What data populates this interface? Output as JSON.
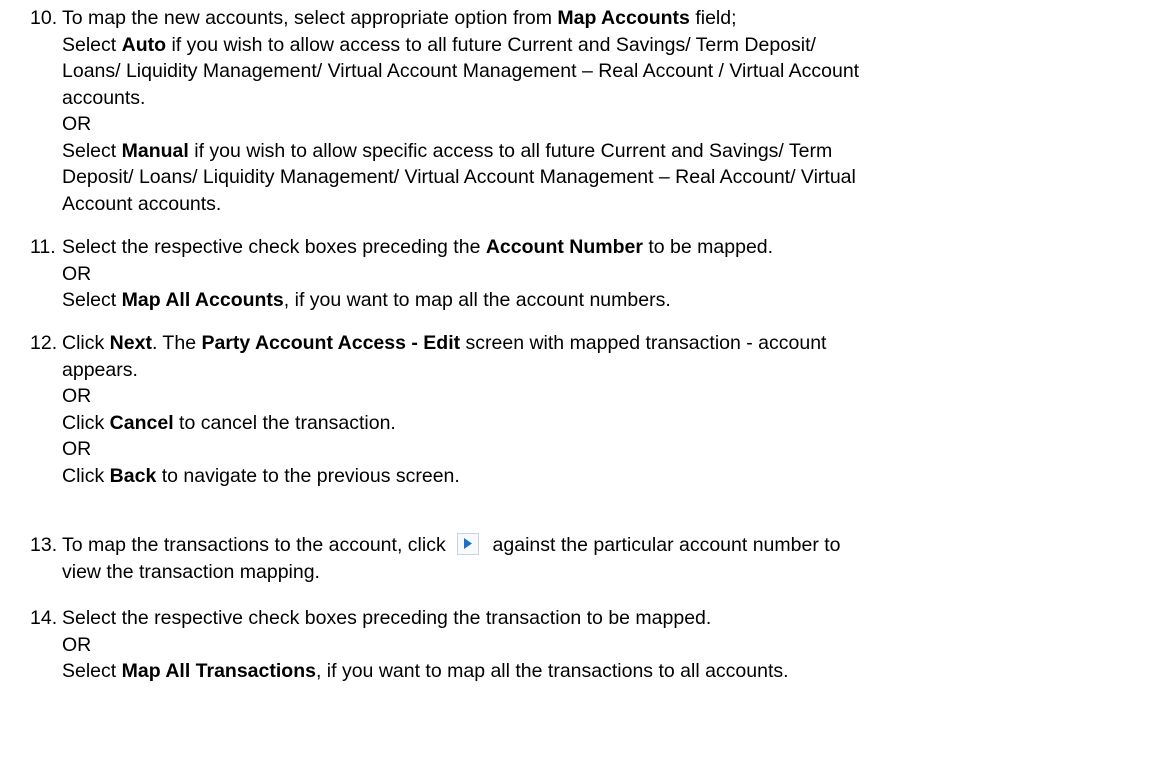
{
  "steps": [
    {
      "number": "10.",
      "lines": [
        [
          "To map the new accounts, select appropriate option from ",
          "Map Accounts",
          " field;"
        ],
        [
          "Select ",
          "Auto",
          " if you wish to allow access to all future Current and Savings/ Term Deposit/"
        ],
        [
          "Loans/ Liquidity Management/ Virtual Account Management – Real Account / Virtual Account"
        ],
        [
          "accounts."
        ],
        [
          "OR"
        ],
        [
          "Select ",
          "Manual",
          " if you wish to allow specific access to all future Current and Savings/ Term"
        ],
        [
          "Deposit/ Loans/ Liquidity Management/ Virtual Account Management – Real Account/  Virtual"
        ],
        [
          "Account accounts."
        ]
      ]
    },
    {
      "number": "11.",
      "lines": [
        [
          "Select the respective check boxes preceding the ",
          "Account Number",
          " to be mapped."
        ],
        [
          "OR"
        ],
        [
          "Select ",
          "Map All Accounts",
          ", if you want to map all the account numbers."
        ]
      ]
    },
    {
      "number": "12.",
      "lines": [
        [
          "Click ",
          "Next",
          ". The ",
          "Party Account Access - Edit",
          " screen with mapped transaction - account"
        ],
        [
          "appears."
        ],
        [
          "OR"
        ],
        [
          "Click ",
          "Cancel",
          " to cancel the transaction."
        ],
        [
          "OR"
        ],
        [
          "Click ",
          "Back",
          " to navigate to the previous screen."
        ]
      ]
    },
    {
      "number": "13.",
      "icon": "expand-arrow-icon",
      "lines": [
        [
          "To map the transactions to the account, click ",
          "[icon]",
          " against the particular account number to"
        ],
        [
          "view the transaction mapping."
        ]
      ]
    },
    {
      "number": "14.",
      "lines": [
        [
          "Select the respective check boxes preceding the transaction to be mapped."
        ],
        [
          "OR"
        ],
        [
          "Select ",
          "Map All Transactions",
          ", if you want to map all the transactions to all accounts."
        ]
      ]
    }
  ],
  "colors": {
    "icon_arrow": "#1f6fc4",
    "icon_border": "#c9d4dd",
    "text": "#000000"
  }
}
